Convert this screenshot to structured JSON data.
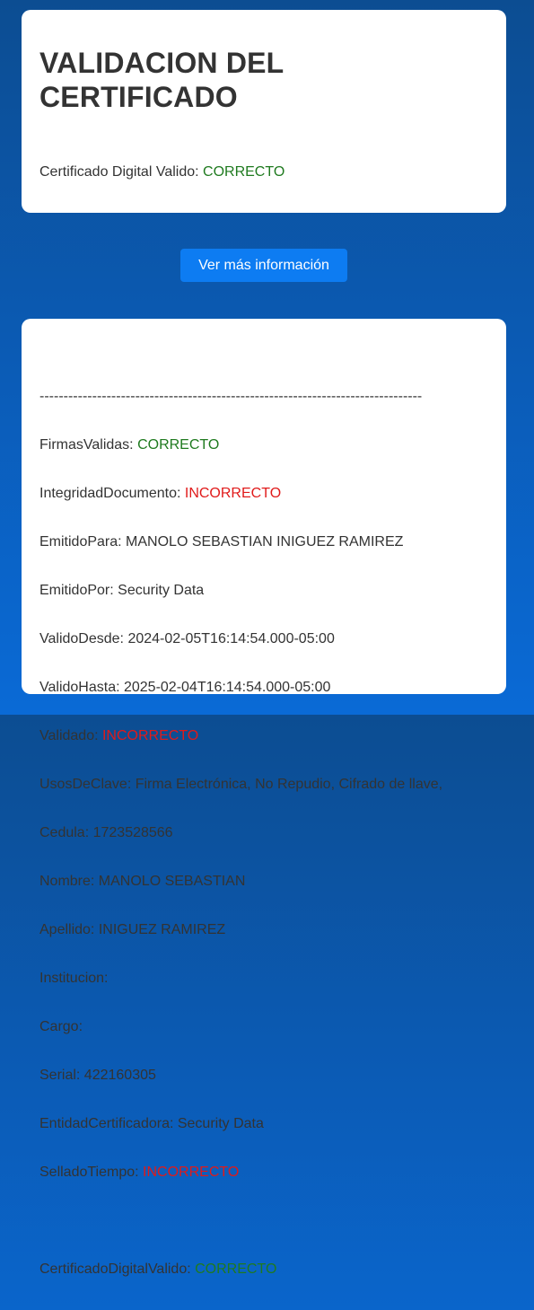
{
  "header_card": {
    "title": "VALIDACION DEL CERTIFICADO",
    "status_label": "Certificado Digital Valido: ",
    "status_value": "CORRECTO"
  },
  "more_button": {
    "label": "Ver más información"
  },
  "details": {
    "separator": "--------------------------------------------------------------------------------",
    "rows": [
      {
        "label": "FirmasValidas: ",
        "value": "CORRECTO",
        "status": "ok"
      },
      {
        "label": "IntegridadDocumento: ",
        "value": "INCORRECTO",
        "status": "bad"
      },
      {
        "label": "EmitidoPara: ",
        "value": "MANOLO SEBASTIAN INIGUEZ RAMIREZ",
        "status": "plain"
      },
      {
        "label": "EmitidoPor: ",
        "value": "Security Data",
        "status": "plain"
      },
      {
        "label": "ValidoDesde: ",
        "value": "2024-02-05T16:14:54.000-05:00",
        "status": "plain"
      },
      {
        "label": "ValidoHasta: ",
        "value": "2025-02-04T16:14:54.000-05:00",
        "status": "plain"
      },
      {
        "label": "Validado: ",
        "value": "INCORRECTO",
        "status": "bad"
      },
      {
        "label": "UsosDeClave: ",
        "value": "Firma Electrónica, No Repudio, Cifrado de llave,",
        "status": "plain"
      },
      {
        "label": "Cedula: ",
        "value": "1723528566",
        "status": "plain"
      },
      {
        "label": "Nombre: ",
        "value": "MANOLO SEBASTIAN",
        "status": "plain"
      },
      {
        "label": "Apellido: ",
        "value": "INIGUEZ RAMIREZ",
        "status": "plain"
      },
      {
        "label": "Institucion: ",
        "value": "",
        "status": "plain"
      },
      {
        "label": "Cargo: ",
        "value": "",
        "status": "plain"
      },
      {
        "label": "Serial: ",
        "value": "422160305",
        "status": "plain"
      },
      {
        "label": "EntidadCertificadora: ",
        "value": "Security Data",
        "status": "plain"
      },
      {
        "label": "SelladoTiempo: ",
        "value": "INCORRECTO",
        "status": "bad"
      }
    ],
    "final_label": "CertificadoDigitalValido: ",
    "final_value": "CORRECTO"
  },
  "colors": {
    "correct": "#1f7a1f",
    "incorrect": "#e01a1a",
    "button": "#0d7cf2"
  }
}
